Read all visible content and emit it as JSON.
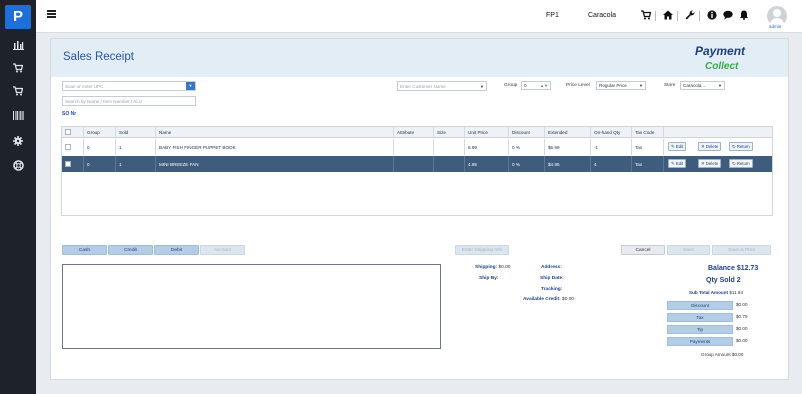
{
  "sidebar": {
    "logo": "P",
    "items": [
      {
        "name": "sidebar-reports",
        "glyph": "▥"
      },
      {
        "name": "sidebar-cart",
        "glyph": "🛒"
      },
      {
        "name": "sidebar-cart-2",
        "glyph": "🛒"
      },
      {
        "name": "sidebar-barcode",
        "glyph": "▮▯▮"
      },
      {
        "name": "sidebar-settings",
        "glyph": "⚙"
      },
      {
        "name": "sidebar-support",
        "glyph": "⊕"
      }
    ]
  },
  "topbar": {
    "station": "FP1",
    "location": "Caracola",
    "user": "admin"
  },
  "page": {
    "title": "Sales Receipt",
    "brand_part1": "Payment",
    "brand_part2": "Collect"
  },
  "filters": {
    "scan_placeholder": "Scan or enter UPC",
    "search_placeholder": "Search by Name / Item Number / ALU",
    "so_nr": "SO Nr",
    "customer_placeholder": "Enter Customer Name",
    "group_label": "Group",
    "group_value": "0",
    "price_level_label": "Price Level",
    "price_level_value": "Regular Price",
    "store_label": "Store",
    "store_value": "Caracola ..."
  },
  "table": {
    "headers": [
      "",
      "Group",
      "Sold",
      "Name",
      "Attribute",
      "Size",
      "Unit Price",
      "Discount",
      "Extended",
      "On-hand Qty",
      "Tax Code",
      ""
    ],
    "rows": [
      {
        "group": "0",
        "sold": "1",
        "name": "BABY FISH FINGER PUPPET BOOK",
        "attribute": "",
        "size": "",
        "unit_price": "6.99",
        "discount": "0 %",
        "extended": "$6.99",
        "onhand": "-1",
        "tax": "Tax",
        "selected": false
      },
      {
        "group": "0",
        "sold": "1",
        "name": "MINI BREEZE FAN",
        "attribute": "",
        "size": "",
        "unit_price": "4.95",
        "discount": "0 %",
        "extended": "$4.95",
        "onhand": "4",
        "tax": "Tax",
        "selected": true
      }
    ],
    "actions": {
      "edit": "Edit",
      "delete": "Delete",
      "return": "Return"
    }
  },
  "payment_buttons": {
    "cash": "Cash",
    "credit": "Credit",
    "debit": "Debit",
    "account": "Account",
    "shipping": "Enter Shipping Info",
    "cancel": "Cancel",
    "save": "Save",
    "save_print": "Save & Print"
  },
  "shipping": {
    "shipping_label": "Shipping:",
    "shipping_value": "$0.00",
    "ship_by_label": "Ship By:",
    "address_label": "Address:",
    "ship_date_label": "Ship Date:",
    "tracking_label": "Tracking:",
    "available_credit_label": "Available Credit:",
    "available_credit_value": "$0.00"
  },
  "summary": {
    "balance_label": "Balance",
    "balance_value": "$12.73",
    "qty_label": "Qty Sold",
    "qty_value": "2",
    "subtotal_label": "Sub Total Amount",
    "subtotal_value": "$11.94",
    "discount_label": "Discount",
    "discount_value": "$0.00",
    "tax_label": "Tax",
    "tax_value": "$0.79",
    "tip_label": "Tip",
    "tip_value": "$0.00",
    "payments_label": "Payments",
    "payments_value": "$0.00",
    "group_amount_label": "Group Amount",
    "group_amount_value": "$0.00"
  }
}
